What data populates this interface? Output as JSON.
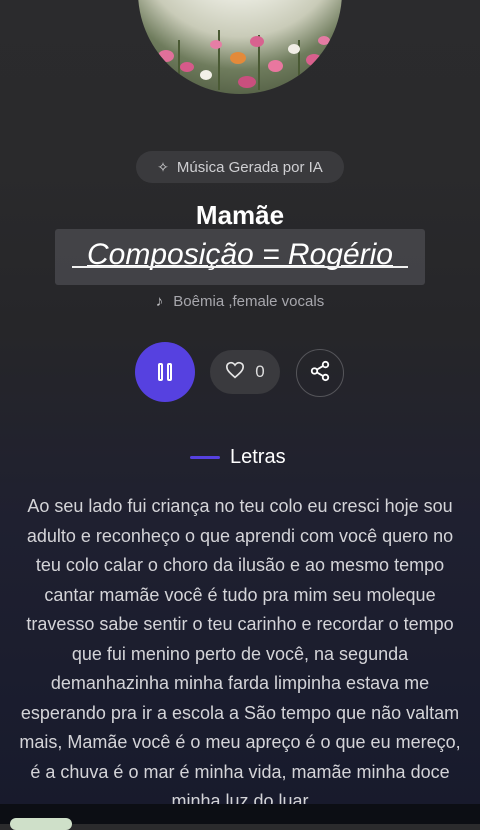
{
  "badge": {
    "icon": "sparkle-icon",
    "label": "Música Gerada por IA"
  },
  "song": {
    "title": "Mamãe",
    "composer": "Composição = Rogério",
    "genre_icon": "music-note-icon",
    "genre": "Boêmia ,female vocals"
  },
  "actions": {
    "pause_icon": "pause-icon",
    "like_icon": "heart-icon",
    "like_count": "0",
    "share_icon": "share-icon"
  },
  "lyrics": {
    "heading": "Letras",
    "text": "Ao seu lado fui criança no teu colo eu cresci hoje sou adulto e reconheço o que aprendi com você quero no teu colo calar o choro da ilusão e ao mesmo tempo cantar mamãe você é tudo pra mim seu moleque travesso sabe sentir o teu carinho e recordar o tempo que fui menino perto de você, na segunda demanhazinha minha farda limpinha estava me esperando pra ir a escola a São tempo que não valtam mais, Mamãe você é o meu apreço é o que eu mereço, é a chuva é o mar é minha vida, mamãe minha doce minha luz do luar"
  },
  "colors": {
    "accent": "#5641e0",
    "background": "#262629"
  }
}
